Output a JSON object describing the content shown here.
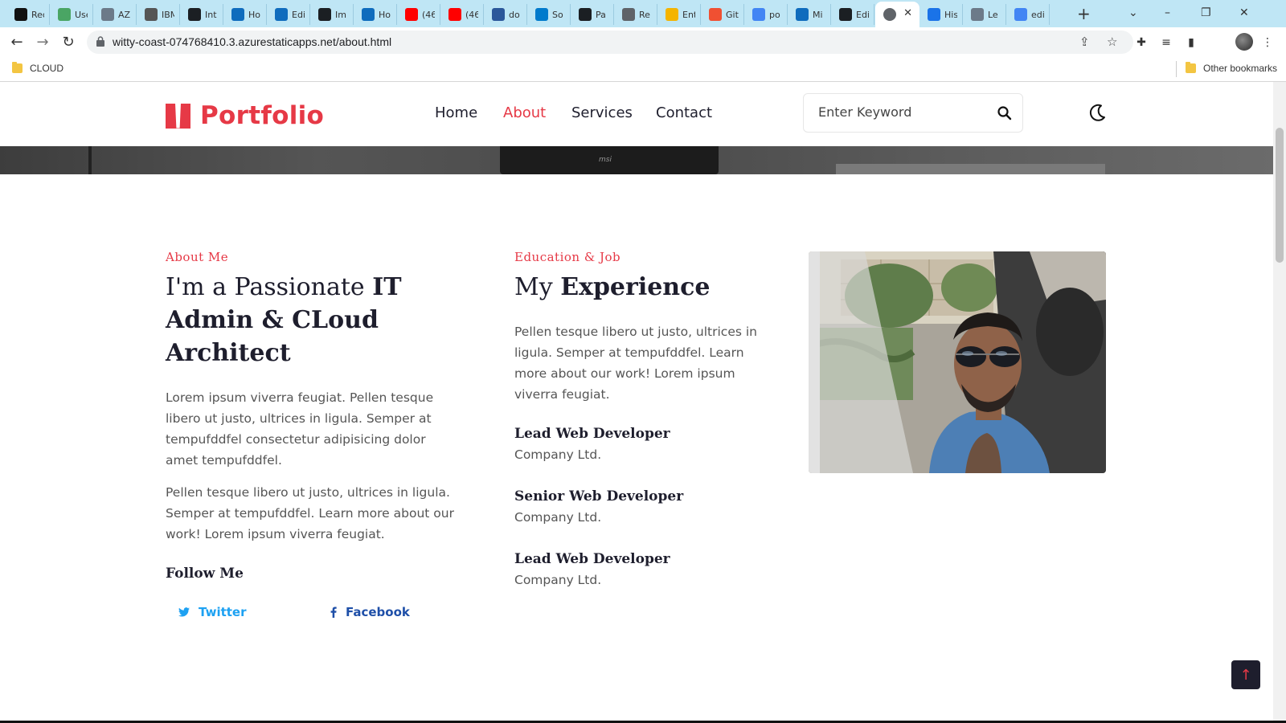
{
  "browser": {
    "tabs": [
      {
        "label": "Rec",
        "color": "#111111"
      },
      {
        "label": "Use",
        "color": "#4aa564"
      },
      {
        "label": "AZ",
        "color": "#6c7a89"
      },
      {
        "label": "IBM",
        "color": "#555555"
      },
      {
        "label": "Int",
        "color": "#1b1f23"
      },
      {
        "label": "Ho",
        "color": "#0f6cbd"
      },
      {
        "label": "Edi",
        "color": "#0f6cbd"
      },
      {
        "label": "Im",
        "color": "#1b1f23"
      },
      {
        "label": "Ho",
        "color": "#0f6cbd"
      },
      {
        "label": "(46",
        "color": "#ff0000"
      },
      {
        "label": "(46",
        "color": "#ff0000"
      },
      {
        "label": "do",
        "color": "#2b579a"
      },
      {
        "label": "So",
        "color": "#007acc"
      },
      {
        "label": "Pa",
        "color": "#1b1f23"
      },
      {
        "label": "Re",
        "color": "#5f6368"
      },
      {
        "label": "Ent",
        "color": "#f4b400"
      },
      {
        "label": "Git",
        "color": "#f05032"
      },
      {
        "label": "po",
        "color": "#4285f4"
      },
      {
        "label": "Mi",
        "color": "#0f6cbd"
      },
      {
        "label": "Edi",
        "color": "#1b1f23"
      },
      {
        "label": "His",
        "color": "#1a73e8"
      },
      {
        "label": "Le",
        "color": "#6c7a89"
      },
      {
        "label": "edi",
        "color": "#4285f4"
      }
    ],
    "url": "witty-coast-074768410.3.azurestaticapps.net/about.html",
    "bookmark_folder": "CLOUD",
    "other_bookmarks": "Other bookmarks"
  },
  "site": {
    "logo": "Portfolio",
    "nav": [
      "Home",
      "About",
      "Services",
      "Contact"
    ],
    "active_nav": "About",
    "search_placeholder": "Enter Keyword",
    "hero_brand": "msi"
  },
  "about": {
    "eyebrow": "About Me",
    "heading_line1_normal": "I'm a Passionate ",
    "heading_line1_bold": "IT",
    "heading_line2": "Admin & CLoud",
    "heading_line3": "Architect",
    "para1": "Lorem ipsum viverra feugiat. Pellen tesque libero ut justo, ultrices in ligula. Semper at tempufddfel consectetur adipisicing dolor amet tempufddfel.",
    "para2": "Pellen tesque libero ut justo, ultrices in ligula. Semper at tempufddfel. Learn more about our work! Lorem ipsum viverra feugiat.",
    "follow_heading": "Follow Me",
    "social": [
      {
        "label": "Twitter",
        "color": "#1da1f2"
      },
      {
        "label": "Facebook",
        "color": "#1e4fa8"
      }
    ]
  },
  "experience": {
    "eyebrow": "Education & Job",
    "heading_normal": "My ",
    "heading_bold": "Experience",
    "intro": "Pellen tesque libero ut justo, ultrices in ligula. Semper at tempufddfel. Learn more about our work! Lorem ipsum viverra feugiat.",
    "jobs": [
      {
        "title": "Lead Web Developer",
        "company": "Company Ltd."
      },
      {
        "title": "Senior Web Developer",
        "company": "Company Ltd."
      },
      {
        "title": "Lead Web Developer",
        "company": "Company Ltd."
      }
    ]
  },
  "colors": {
    "accent": "#e63946",
    "dark": "#1e1e2d",
    "text": "#555555"
  }
}
